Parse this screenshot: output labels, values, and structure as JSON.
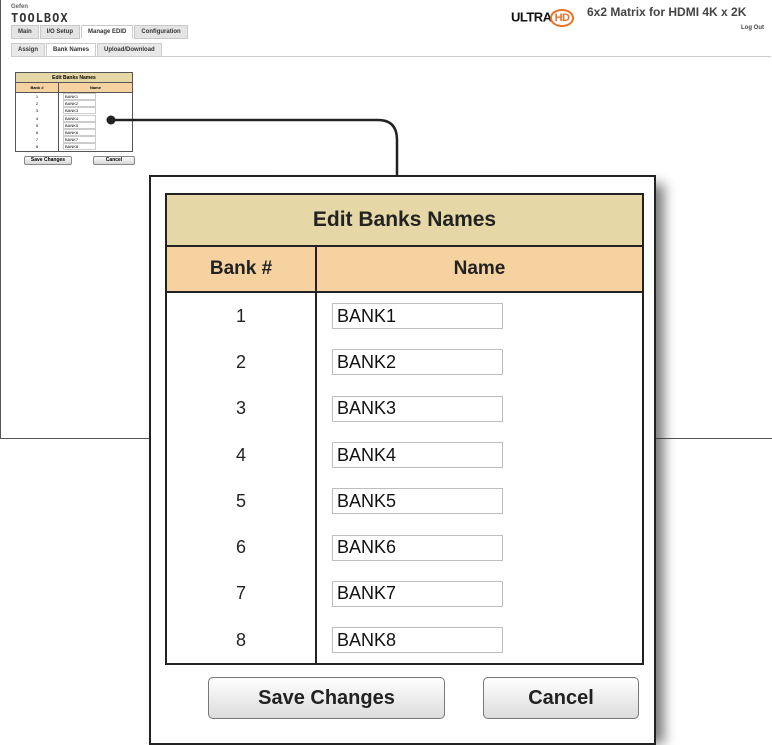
{
  "header": {
    "logo_small": "Gefen",
    "logo_main": "TOOLBOX",
    "ultra_text": "ULTRA",
    "hd_text": "HD",
    "product_title": "6x2 Matrix for HDMI 4K x 2K",
    "logout_label": "Log Out"
  },
  "main_tabs": [
    {
      "label": "Main"
    },
    {
      "label": "I/O Setup"
    },
    {
      "label": "Manage EDID"
    },
    {
      "label": "Configuration"
    }
  ],
  "sub_tabs": [
    {
      "label": "Assign"
    },
    {
      "label": "Bank Names"
    },
    {
      "label": "Upload/Download"
    }
  ],
  "panel": {
    "title": "Edit Banks Names",
    "col_bank": "Bank #",
    "col_name": "Name",
    "rows": [
      {
        "num": "1",
        "name": "BANK1"
      },
      {
        "num": "2",
        "name": "BANK2"
      },
      {
        "num": "3",
        "name": "BANK3"
      },
      {
        "num": "4",
        "name": "BANK4"
      },
      {
        "num": "5",
        "name": "BANK5"
      },
      {
        "num": "6",
        "name": "BANK6"
      },
      {
        "num": "7",
        "name": "BANK7"
      },
      {
        "num": "8",
        "name": "BANK8"
      }
    ],
    "save_label": "Save Changes",
    "cancel_label": "Cancel"
  },
  "colors": {
    "title_bg": "#e6d7a7",
    "header_bg": "#f5d2a0",
    "hd_accent": "#e8732a"
  }
}
